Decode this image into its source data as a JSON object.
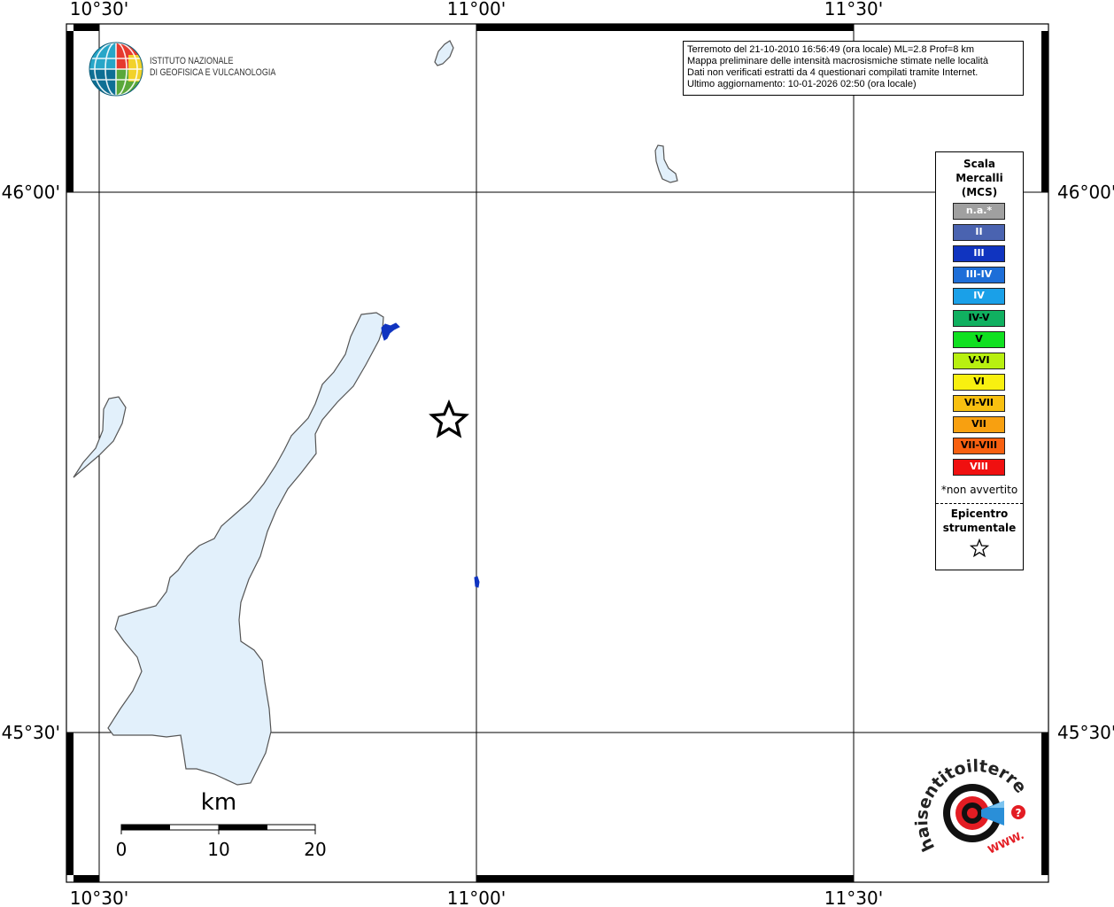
{
  "map": {
    "lon_ticks": [
      "10°30'",
      "11°00'",
      "11°30'"
    ],
    "lat_ticks": [
      "46°00'",
      "45°30'"
    ],
    "scalebar": {
      "unit": "km",
      "labels": [
        "0",
        "10",
        "20"
      ]
    },
    "epicenter_symbol": "star-icon"
  },
  "info": {
    "line1": "Terremoto del 21-10-2010 16:56:49 (ora locale) ML=2.8 Prof=8 km",
    "line2": "Mappa preliminare delle intensità macrosismiche stimate nelle località",
    "line3": "Dati non verificati estratti da 4 questionari compilati tramite Internet.",
    "line4": "Ultimo aggiornamento: 10-01-2026 02:50 (ora locale)"
  },
  "legend": {
    "title_line1": "Scala",
    "title_line2": "Mercalli",
    "title_line3": "(MCS)",
    "items": [
      {
        "label": "n.a.*",
        "color": "#a0a0a0",
        "text_color": "#ffffff"
      },
      {
        "label": "II",
        "color": "#4a63b0",
        "text_color": "#ffffff"
      },
      {
        "label": "III",
        "color": "#1034c0",
        "text_color": "#ffffff"
      },
      {
        "label": "III-IV",
        "color": "#1d6ed8",
        "text_color": "#ffffff"
      },
      {
        "label": "IV",
        "color": "#1aa0e8",
        "text_color": "#ffffff"
      },
      {
        "label": "IV-V",
        "color": "#10b060",
        "text_color": "#000000"
      },
      {
        "label": "V",
        "color": "#10e020",
        "text_color": "#000000"
      },
      {
        "label": "V-VI",
        "color": "#b8f010",
        "text_color": "#000000"
      },
      {
        "label": "VI",
        "color": "#f8f010",
        "text_color": "#000000"
      },
      {
        "label": "VI-VII",
        "color": "#f8c010",
        "text_color": "#000000"
      },
      {
        "label": "VII",
        "color": "#f8a010",
        "text_color": "#000000"
      },
      {
        "label": "VII-VIII",
        "color": "#f86010",
        "text_color": "#000000"
      },
      {
        "label": "VIII",
        "color": "#f01010",
        "text_color": "#ffffff"
      }
    ],
    "note": "*non avvertito",
    "epicenter_line1": "Epicentro",
    "epicenter_line2": "strumentale"
  },
  "logos": {
    "ingv_line1": "ISTITUTO NAZIONALE",
    "ingv_line2": "DI GEOFISICA E VULCANOLOGIA",
    "haisentito_text": "haisentitoilterremoto.it",
    "haisentito_url": "WWW."
  },
  "colors": {
    "water": "#e2f0fb",
    "shore": "#555555",
    "frame": "#000000"
  }
}
